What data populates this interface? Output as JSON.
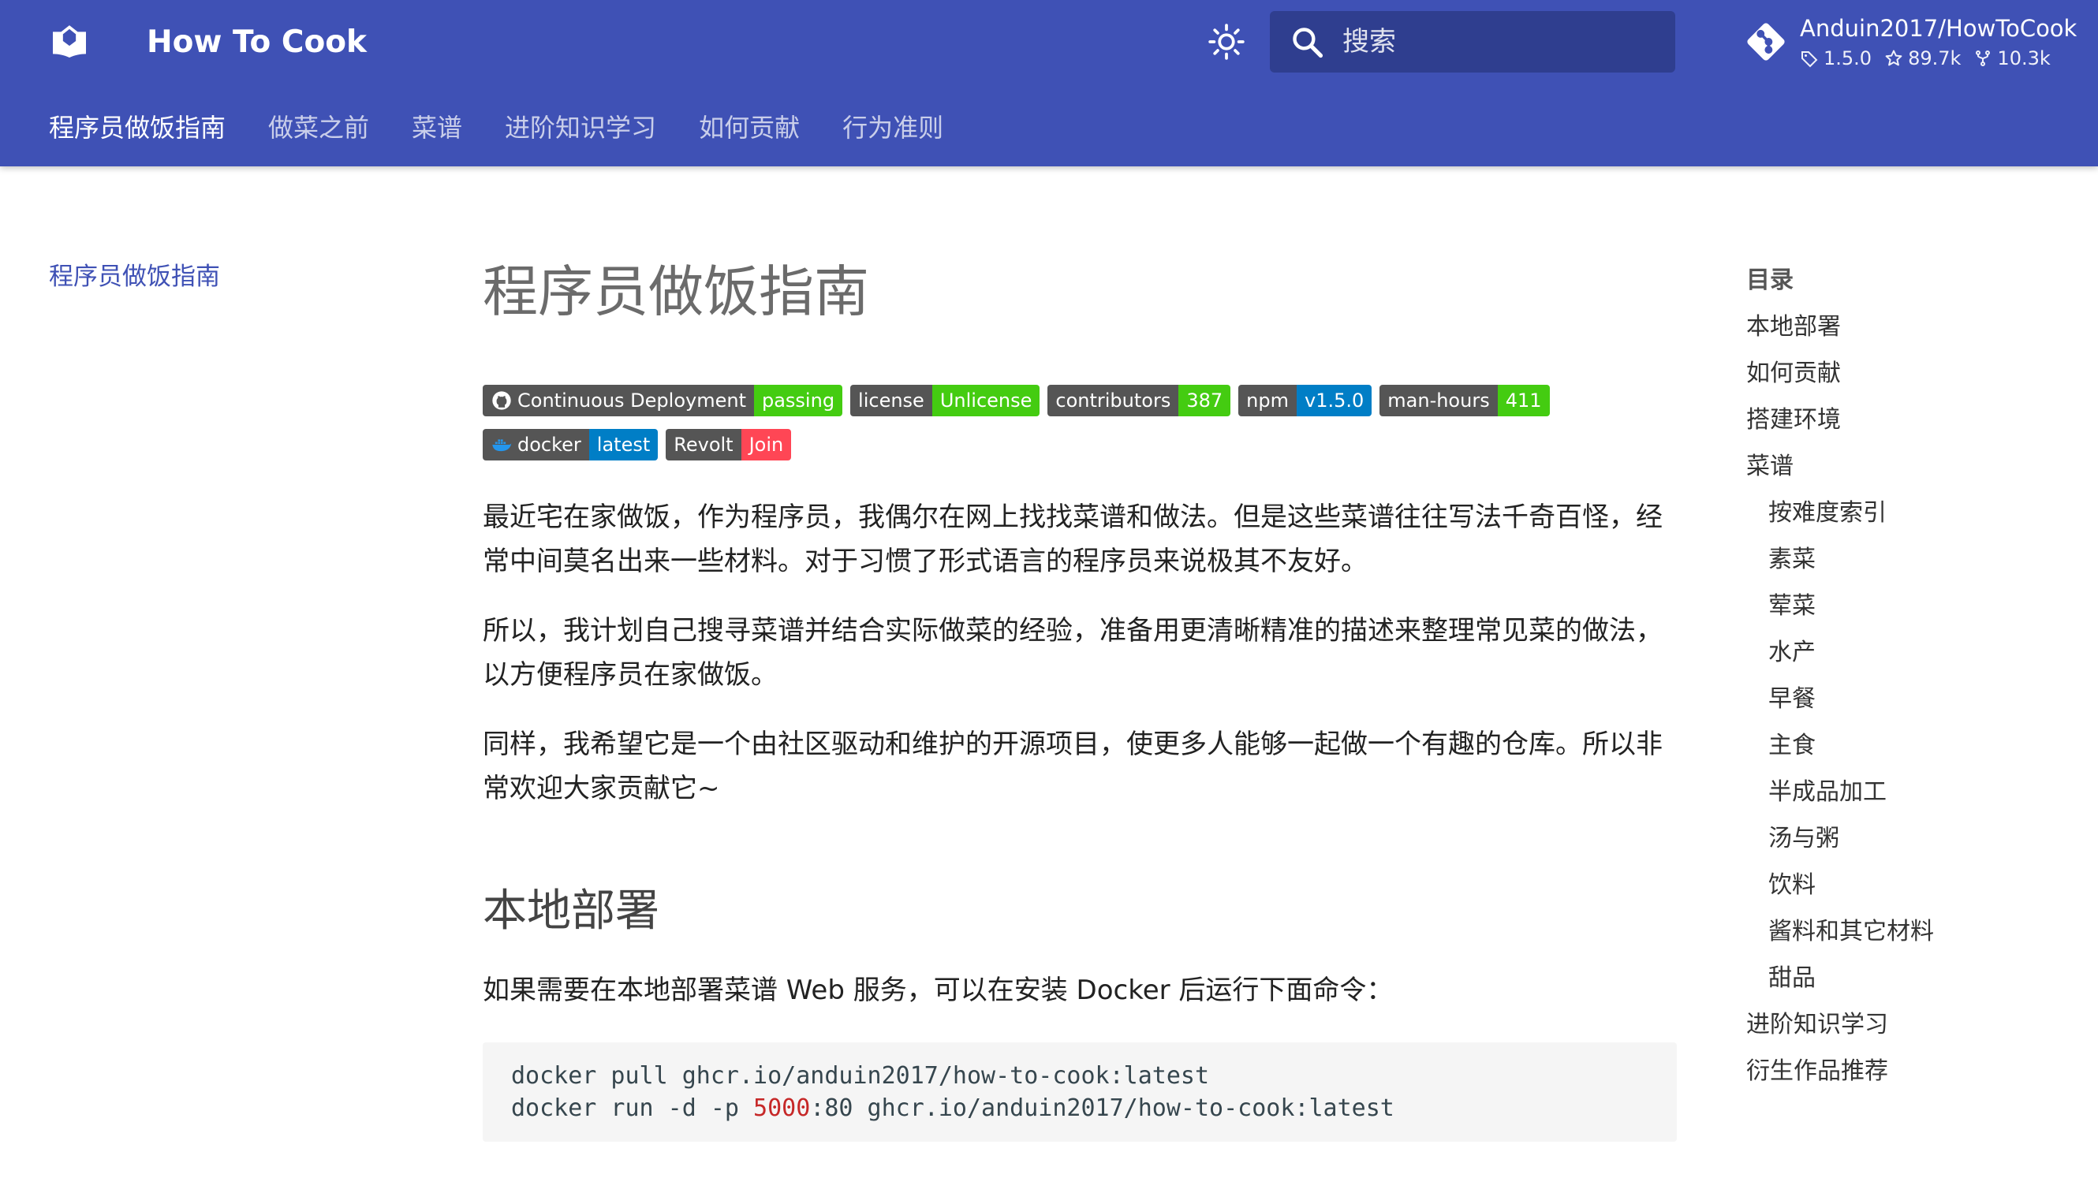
{
  "header": {
    "site_title": "How To Cook",
    "search_placeholder": "搜索",
    "repo": {
      "name": "Anduin2017/HowToCook",
      "version": "1.5.0",
      "stars": "89.7k",
      "forks": "10.3k"
    },
    "tabs": [
      {
        "label": "程序员做饭指南",
        "active": true
      },
      {
        "label": "做菜之前"
      },
      {
        "label": "菜谱"
      },
      {
        "label": "进阶知识学习"
      },
      {
        "label": "如何贡献"
      },
      {
        "label": "行为准则"
      }
    ],
    "colors": {
      "primary": "#3f51b5"
    }
  },
  "left_nav": {
    "label": "程序员做饭指南"
  },
  "content": {
    "title": "程序员做饭指南",
    "badges": [
      {
        "label": "Continuous Deployment",
        "value": "passing",
        "color": "#4c1",
        "icon": "github-icon"
      },
      {
        "label": "license",
        "value": "Unlicense",
        "color": "#4c1"
      },
      {
        "label": "contributors",
        "value": "387",
        "color": "#4c1"
      },
      {
        "label": "npm",
        "value": "v1.5.0",
        "color": "#007ec6"
      },
      {
        "label": "man-hours",
        "value": "411",
        "color": "#4c1"
      },
      {
        "label": "docker",
        "value": "latest",
        "color": "#007ec6",
        "icon": "docker-icon"
      },
      {
        "label": "Revolt",
        "value": "Join",
        "color": "#ff4655"
      }
    ],
    "paragraphs": [
      "最近宅在家做饭，作为程序员，我偶尔在网上找找菜谱和做法。但是这些菜谱往往写法千奇百怪，经常中间莫名出来一些材料。对于习惯了形式语言的程序员来说极其不友好。",
      "所以，我计划自己搜寻菜谱并结合实际做菜的经验，准备用更清晰精准的描述来整理常见菜的做法，以方便程序员在家做饭。",
      "同样，我希望它是一个由社区驱动和维护的开源项目，使更多人能够一起做一个有趣的仓库。所以非常欢迎大家贡献它~"
    ],
    "section_title": "本地部署",
    "section_text": "如果需要在本地部署菜谱 Web 服务，可以在安装 Docker 后运行下面命令：",
    "code": {
      "line1": "docker pull ghcr.io/anduin2017/how-to-cook:latest",
      "line2_prefix": "docker run -d -p ",
      "line2_num": "5000",
      "line2_suffix": ":80 ghcr.io/anduin2017/how-to-cook:latest"
    }
  },
  "toc": {
    "title": "目录",
    "items": [
      {
        "label": "本地部署"
      },
      {
        "label": "如何贡献"
      },
      {
        "label": "搭建环境"
      },
      {
        "label": "菜谱"
      },
      {
        "label": "按难度索引",
        "sub": true
      },
      {
        "label": "素菜",
        "sub": true
      },
      {
        "label": "荤菜",
        "sub": true
      },
      {
        "label": "水产",
        "sub": true
      },
      {
        "label": "早餐",
        "sub": true
      },
      {
        "label": "主食",
        "sub": true
      },
      {
        "label": "半成品加工",
        "sub": true
      },
      {
        "label": "汤与粥",
        "sub": true
      },
      {
        "label": "饮料",
        "sub": true
      },
      {
        "label": "酱料和其它材料",
        "sub": true
      },
      {
        "label": "甜品",
        "sub": true
      },
      {
        "label": "进阶知识学习"
      },
      {
        "label": "衍生作品推荐"
      }
    ]
  }
}
